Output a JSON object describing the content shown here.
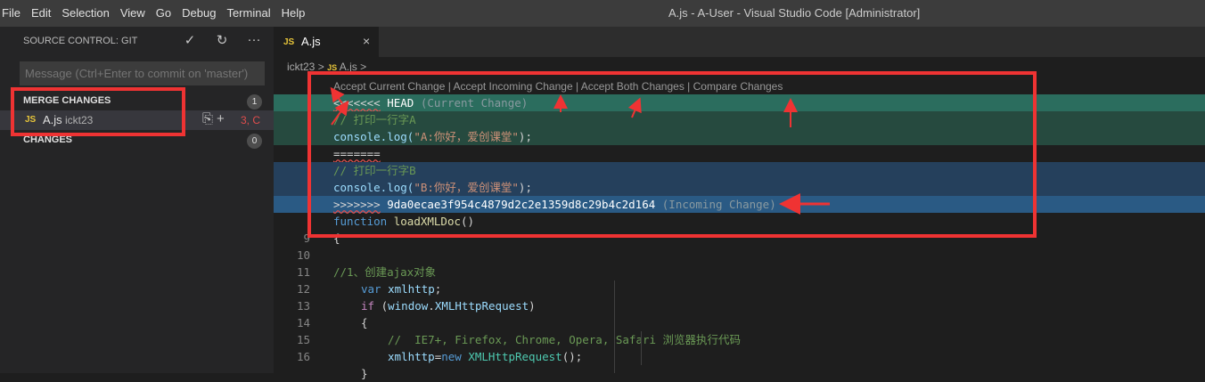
{
  "menubar": {
    "items": [
      "File",
      "Edit",
      "Selection",
      "View",
      "Go",
      "Debug",
      "Terminal",
      "Help"
    ],
    "window_title": "A.js - A-User - Visual Studio Code [Administrator]"
  },
  "sidebar": {
    "title": "SOURCE CONTROL: GIT",
    "commit_placeholder": "Message (Ctrl+Enter to commit on 'master')",
    "merge_changes": {
      "label": "MERGE CHANGES",
      "count": "1",
      "file": {
        "icon": "JS",
        "name": "A.js",
        "path": "ickt23",
        "status": "3, C"
      }
    },
    "changes": {
      "label": "CHANGES",
      "count": "0"
    }
  },
  "editor": {
    "tab": {
      "icon": "JS",
      "name": "A.js",
      "close": "×"
    },
    "breadcrumb": {
      "folder": "ickt23",
      "sep": ">",
      "icon": "JS",
      "file": "A.js",
      "sep2": ">"
    },
    "codelens": {
      "accept_current": "Accept Current Change",
      "accept_incoming": "Accept Incoming Change",
      "accept_both": "Accept Both Changes",
      "compare": "Compare Changes",
      "separator": " | "
    },
    "conflict": {
      "head_marker": "<<<<<<<",
      "head_ref": "HEAD",
      "head_note": "(Current Change)",
      "current_comment": "// 打印一行字A",
      "current_code_pre": "console.log(",
      "current_code_str": "\"A:你好，爱创课堂\"",
      "current_code_post": ");",
      "divider": "=======",
      "incoming_comment": "// 打印一行字B",
      "incoming_code_pre": "console.log(",
      "incoming_code_str": "\"B:你好，爱创课堂\"",
      "incoming_code_post": ");",
      "incoming_marker": ">>>>>>>",
      "incoming_ref": "9da0ecae3f954c4879d2c2e1359d8c29b4c2d164",
      "incoming_note": "(Incoming Change)"
    },
    "lines": {
      "fn_kw": "function",
      "fn_name": "loadXMLDoc",
      "fn_paren": "()",
      "l9_num": "9",
      "l9": "{",
      "l10_num": "10",
      "l11_num": "11",
      "l11": "//1、创建ajax对象",
      "l12_num": "12",
      "l12_kw": "var",
      "l12_var": "xmlhttp",
      "l12_end": ";",
      "l13_num": "13",
      "l13_kw": "if",
      "l13_open": " (",
      "l13_obj": "window",
      "l13_dot": ".",
      "l13_prop": "XMLHttpRequest",
      "l13_close": ")",
      "l14_num": "14",
      "l14": "{",
      "l15_num": "15",
      "l15": "//  IE7+, Firefox, Chrome, Opera, Safari 浏览器执行代码",
      "l16_num": "16",
      "l16_var": "xmlhttp",
      "l16_eq": "=",
      "l16_kw": "new",
      "l16_cls": "XMLHttpRequest",
      "l16_end": "();",
      "l17": "}"
    }
  },
  "colors": {
    "annotation_red": "#ef3333",
    "current_header": "#2b6d5e",
    "current_body": "#264a3f",
    "incoming_body": "#25405c",
    "incoming_header": "#2a5a84"
  }
}
